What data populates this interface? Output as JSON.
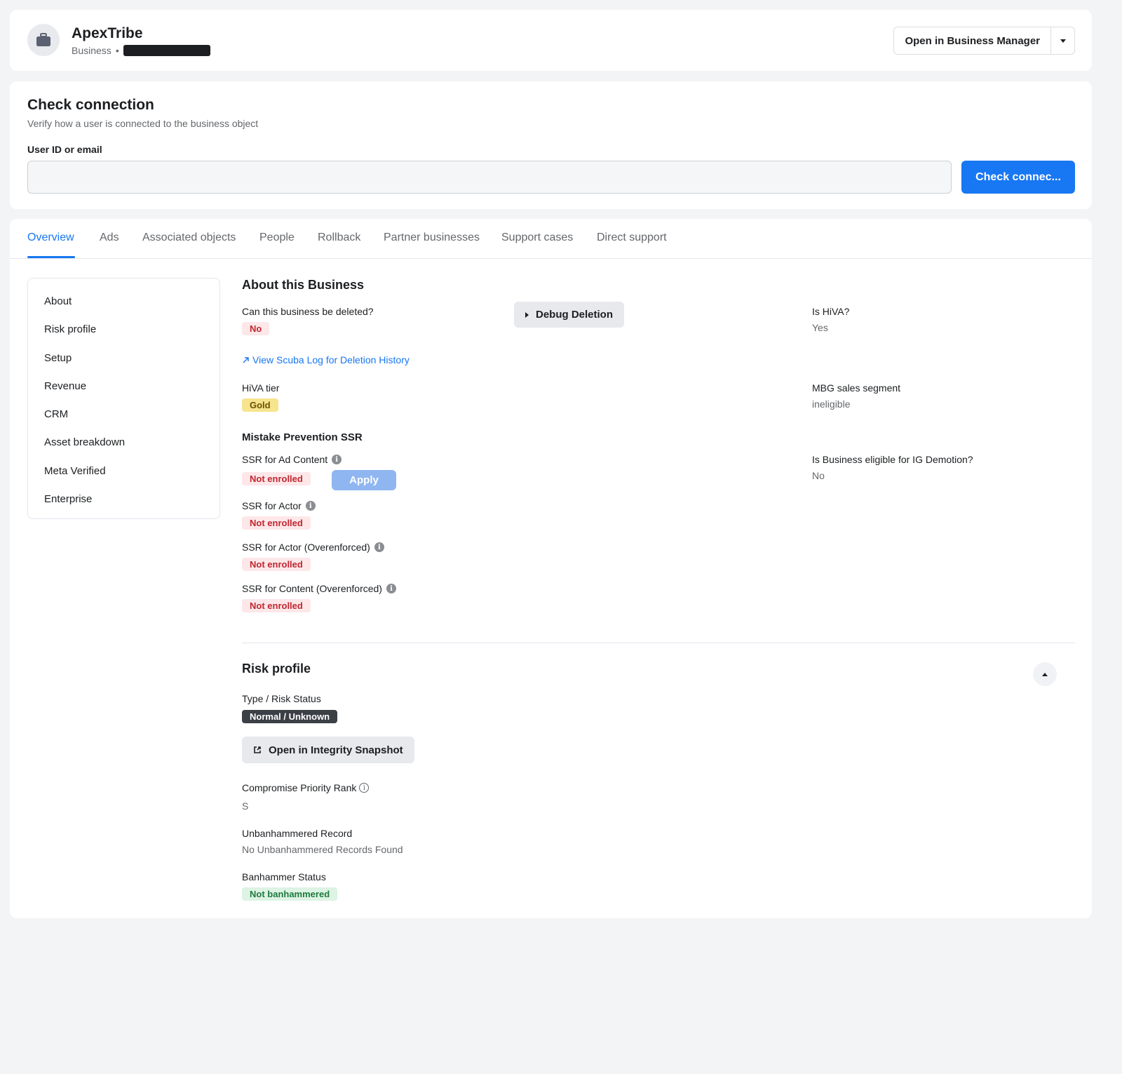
{
  "header": {
    "business_name": "ApexTribe",
    "business_type": "Business",
    "separator": "•",
    "open_manager_label": "Open in Business Manager"
  },
  "check_connection": {
    "title": "Check connection",
    "subtitle": "Verify how a user is connected to the business object",
    "field_label": "User ID or email",
    "input_value": "",
    "button_label": "Check connec..."
  },
  "tabs": [
    {
      "label": "Overview",
      "active": true
    },
    {
      "label": "Ads"
    },
    {
      "label": "Associated objects"
    },
    {
      "label": "People"
    },
    {
      "label": "Rollback"
    },
    {
      "label": "Partner businesses"
    },
    {
      "label": "Support cases"
    },
    {
      "label": "Direct support"
    }
  ],
  "sidebar": {
    "items": [
      "About",
      "Risk profile",
      "Setup",
      "Revenue",
      "CRM",
      "Asset breakdown",
      "Meta Verified",
      "Enterprise"
    ]
  },
  "about": {
    "title": "About this Business",
    "can_delete_label": "Can this business be deleted?",
    "can_delete_value": "No",
    "debug_deletion_label": "Debug Deletion",
    "scuba_link": "View Scuba Log for Deletion History",
    "is_hiva_label": "Is HiVA?",
    "is_hiva_value": "Yes",
    "hiva_tier_label": "HiVA tier",
    "hiva_tier_value": "Gold",
    "mbg_label": "MBG sales segment",
    "mbg_value": "ineligible",
    "ig_demotion_label": "Is Business eligible for IG Demotion?",
    "ig_demotion_value": "No"
  },
  "ssr": {
    "title": "Mistake Prevention SSR",
    "items": [
      {
        "label": "SSR for Ad Content",
        "status": "Not enrolled"
      },
      {
        "label": "SSR for Actor",
        "status": "Not enrolled"
      },
      {
        "label": "SSR for Actor (Overenforced)",
        "status": "Not enrolled"
      },
      {
        "label": "SSR for Content (Overenforced)",
        "status": "Not enrolled"
      }
    ],
    "apply_label": "Apply"
  },
  "risk": {
    "title": "Risk profile",
    "type_label": "Type / Risk Status",
    "type_value": "Normal / Unknown",
    "snapshot_label": "Open in Integrity Snapshot",
    "priority_label": "Compromise Priority Rank",
    "priority_value": "S",
    "unban_label": "Unbanhammered Record",
    "unban_value": "No Unbanhammered Records Found",
    "ban_label": "Banhammer Status",
    "ban_value": "Not banhammered"
  },
  "colors": {
    "accent": "#1877f2",
    "danger": "#c0262f",
    "success": "#1f7a3c"
  }
}
